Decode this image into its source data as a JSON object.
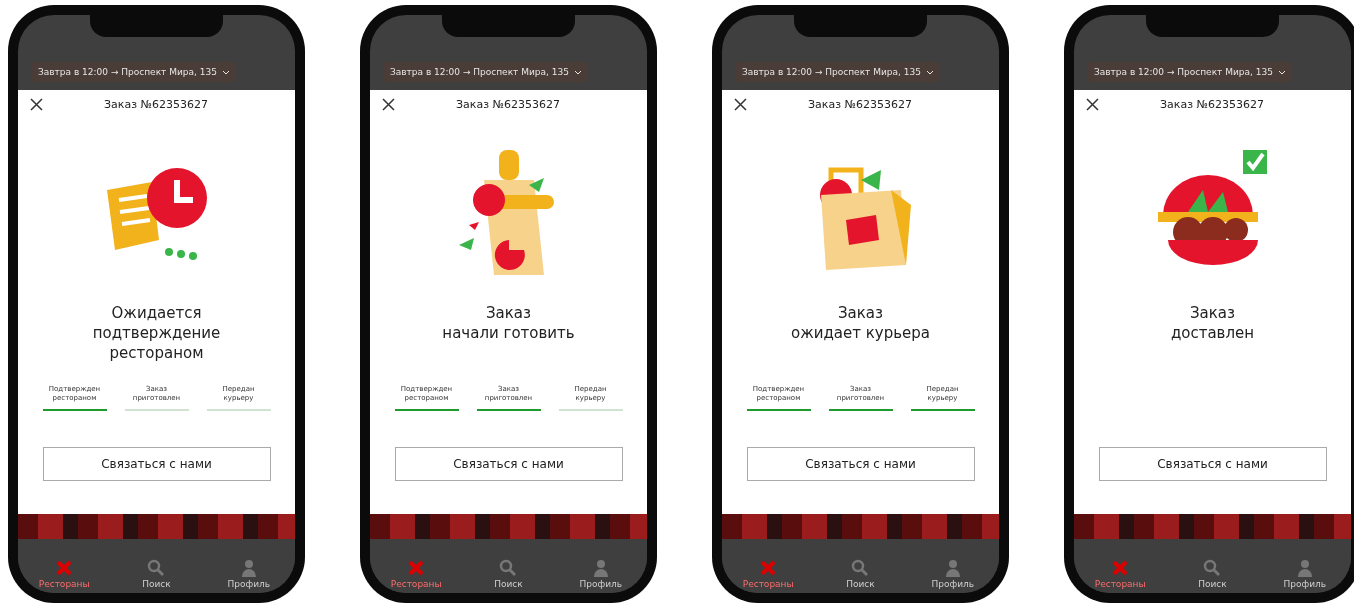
{
  "screens": [
    {
      "address": "Завтра в 12:00 → Проспект Мира, 135",
      "title": "Заказ №62353627",
      "message": "Ожидается\nподтверждение\nрестораном",
      "steps": [
        {
          "label": "Подтвержден\nрестораном",
          "done": true
        },
        {
          "label": "Заказ\nприготовлен",
          "done": false
        },
        {
          "label": "Передан\nкурьеру",
          "done": false
        }
      ],
      "button": "Связаться с нами",
      "tabs": [
        {
          "label": "Рестораны",
          "selected": true
        },
        {
          "label": "Поиск",
          "selected": false
        },
        {
          "label": "Профиль",
          "selected": false
        }
      ]
    },
    {
      "address": "Завтра в 12:00 → Проспект Мира, 135",
      "title": "Заказ №62353627",
      "message": "Заказ\nначали готовить",
      "steps": [
        {
          "label": "Подтвержден\nрестораном",
          "done": true
        },
        {
          "label": "Заказ\nприготовлен",
          "done": true
        },
        {
          "label": "Передан\nкурьеру",
          "done": false
        }
      ],
      "button": "Связаться с нами",
      "tabs": [
        {
          "label": "Рестораны",
          "selected": true
        },
        {
          "label": "Поиск",
          "selected": false
        },
        {
          "label": "Профиль",
          "selected": false
        }
      ]
    },
    {
      "address": "Завтра в 12:00 → Проспект Мира, 135",
      "title": "Заказ №62353627",
      "message": "Заказ\nожидает курьера",
      "steps": [
        {
          "label": "Подтвержден\nрестораном",
          "done": true
        },
        {
          "label": "Заказ\nприготовлен",
          "done": true
        },
        {
          "label": "Передан\nкурьеру",
          "done": true
        }
      ],
      "button": "Связаться с нами",
      "tabs": [
        {
          "label": "Рестораны",
          "selected": true
        },
        {
          "label": "Поиск",
          "selected": false
        },
        {
          "label": "Профиль",
          "selected": false
        }
      ]
    },
    {
      "address": "Завтра в 12:00 → Проспект Мира, 135",
      "title": "Заказ №62353627",
      "message": "Заказ\nдоставлен",
      "button": "Связаться с нами",
      "tabs": [
        {
          "label": "Рестораны",
          "selected": true
        },
        {
          "label": "Поиск",
          "selected": false
        },
        {
          "label": "Профиль",
          "selected": false
        }
      ]
    }
  ]
}
